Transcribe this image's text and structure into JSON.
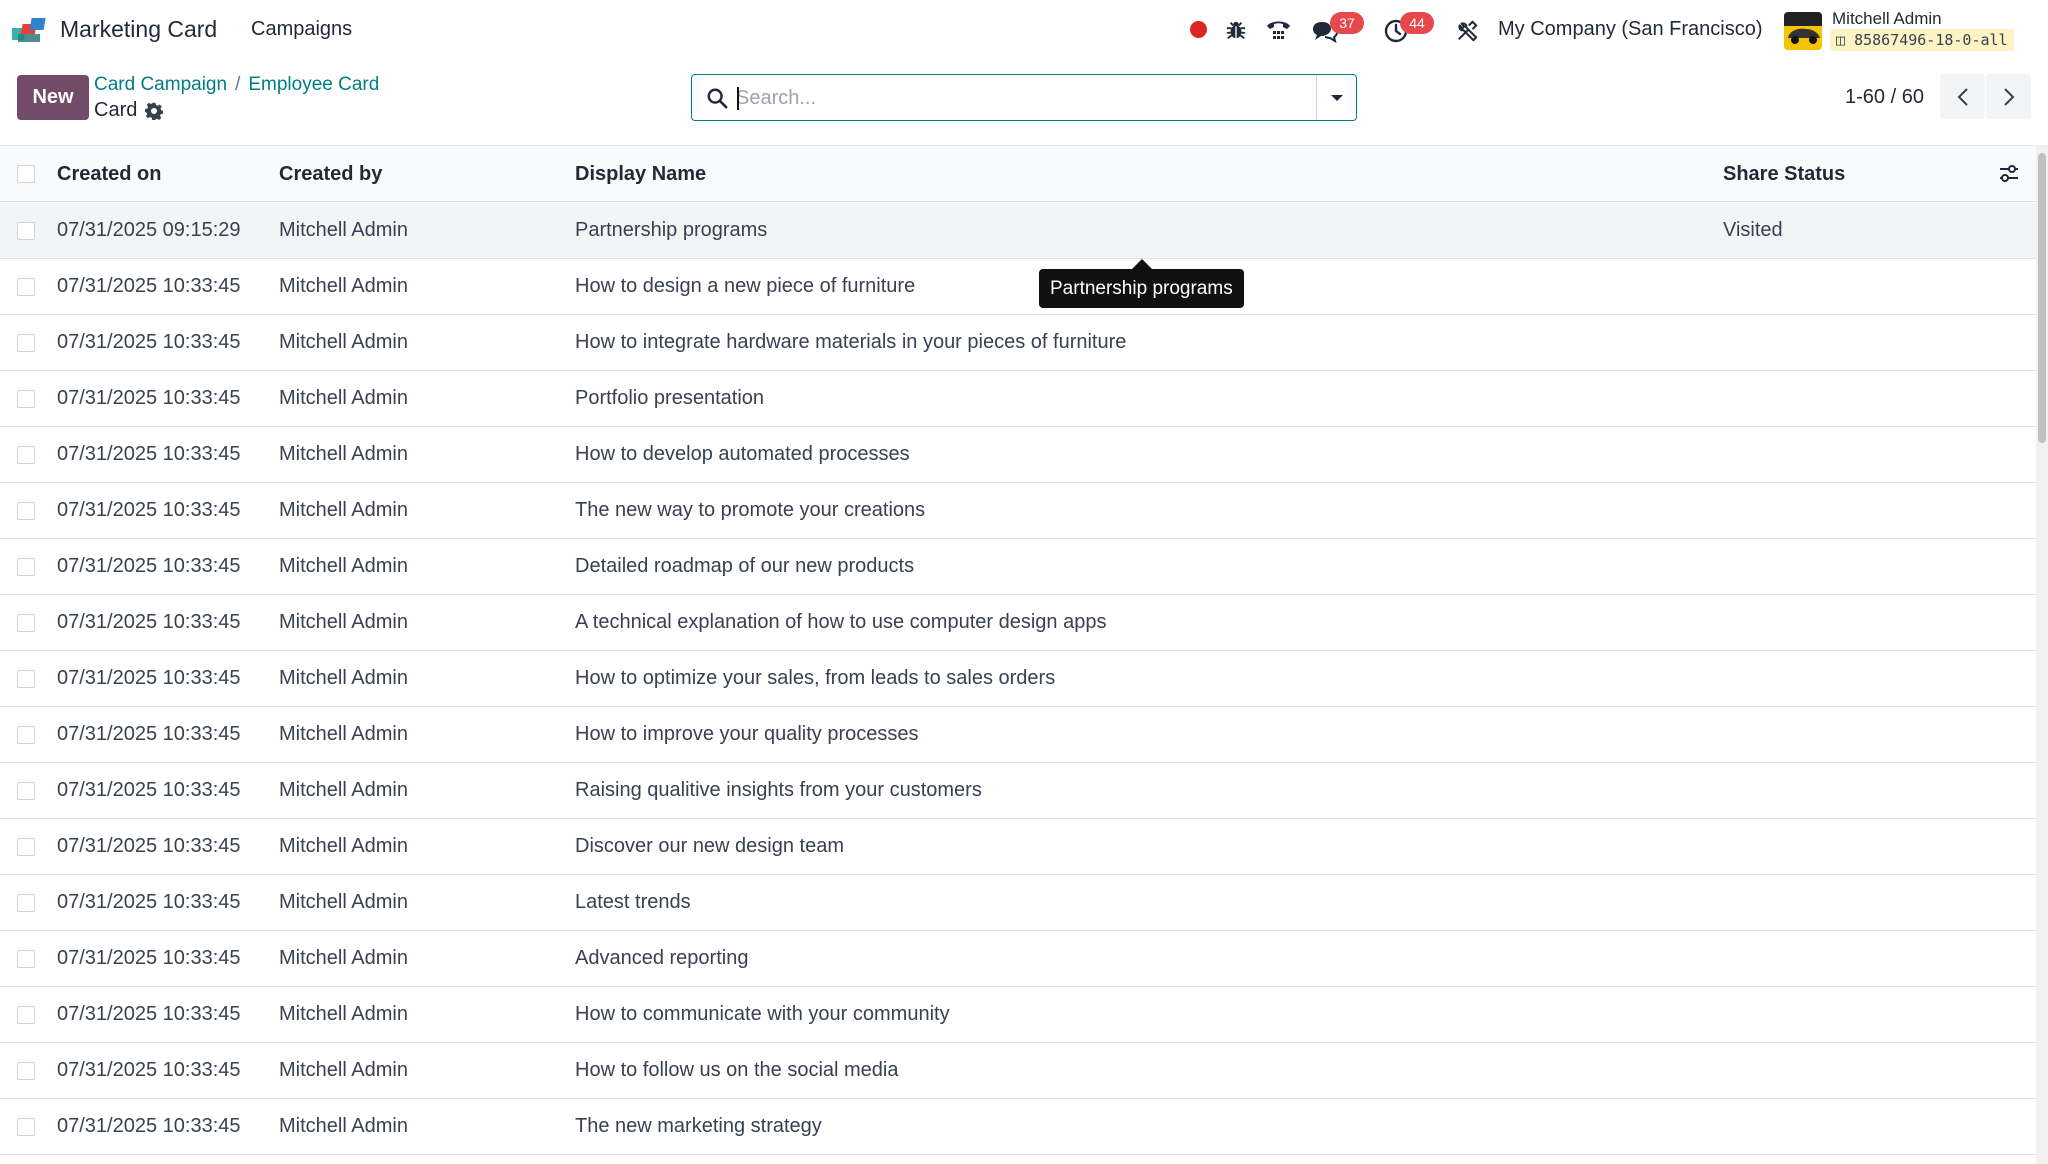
{
  "navbar": {
    "app_name": "Marketing Card",
    "menu_items": [
      "Campaigns"
    ],
    "discuss_count": "37",
    "activities_count": "44",
    "company": "My Company (San Francisco)",
    "user_name": "Mitchell Admin",
    "db_name": "85867496-18-0-all"
  },
  "control_panel": {
    "new_label": "New",
    "breadcrumbs": [
      "Card Campaign",
      "Employee Card"
    ],
    "current": "Card",
    "search_placeholder": "Search...",
    "pager_value": "1-60 / 60"
  },
  "table": {
    "headers": [
      "Created on",
      "Created by",
      "Display Name",
      "Share Status"
    ],
    "rows": [
      [
        "07/31/2025 09:15:29",
        "Mitchell Admin",
        "Partnership programs",
        "Visited"
      ],
      [
        "07/31/2025 10:33:45",
        "Mitchell Admin",
        "How to design a new piece of furniture",
        ""
      ],
      [
        "07/31/2025 10:33:45",
        "Mitchell Admin",
        "How to integrate hardware materials in your pieces of furniture",
        ""
      ],
      [
        "07/31/2025 10:33:45",
        "Mitchell Admin",
        "Portfolio presentation",
        ""
      ],
      [
        "07/31/2025 10:33:45",
        "Mitchell Admin",
        "How to develop automated processes",
        ""
      ],
      [
        "07/31/2025 10:33:45",
        "Mitchell Admin",
        "The new way to promote your creations",
        ""
      ],
      [
        "07/31/2025 10:33:45",
        "Mitchell Admin",
        "Detailed roadmap of our new products",
        ""
      ],
      [
        "07/31/2025 10:33:45",
        "Mitchell Admin",
        "A technical explanation of how to use computer design apps",
        ""
      ],
      [
        "07/31/2025 10:33:45",
        "Mitchell Admin",
        "How to optimize your sales, from leads to sales orders",
        ""
      ],
      [
        "07/31/2025 10:33:45",
        "Mitchell Admin",
        "How to improve your quality processes",
        ""
      ],
      [
        "07/31/2025 10:33:45",
        "Mitchell Admin",
        "Raising qualitive insights from your customers",
        ""
      ],
      [
        "07/31/2025 10:33:45",
        "Mitchell Admin",
        "Discover our new design team",
        ""
      ],
      [
        "07/31/2025 10:33:45",
        "Mitchell Admin",
        "Latest trends",
        ""
      ],
      [
        "07/31/2025 10:33:45",
        "Mitchell Admin",
        "Advanced reporting",
        ""
      ],
      [
        "07/31/2025 10:33:45",
        "Mitchell Admin",
        "How to communicate with your community",
        ""
      ],
      [
        "07/31/2025 10:33:45",
        "Mitchell Admin",
        "How to follow us on the social media",
        ""
      ],
      [
        "07/31/2025 10:33:45",
        "Mitchell Admin",
        "The new marketing strategy",
        ""
      ]
    ]
  },
  "tooltip": {
    "text": "Partnership programs"
  },
  "colors": {
    "brand": "#714b67",
    "link": "#017e84",
    "badge": "#e5484d",
    "recording": "#dc2626"
  },
  "icons": [
    "app-logo-icon",
    "recording-dot-icon",
    "bug-icon",
    "phone-icon",
    "chat-icon",
    "clock-icon",
    "tools-icon",
    "gear-icon",
    "search-icon",
    "caret-down-icon",
    "chevron-left-icon",
    "chevron-right-icon",
    "column-settings-icon"
  ]
}
